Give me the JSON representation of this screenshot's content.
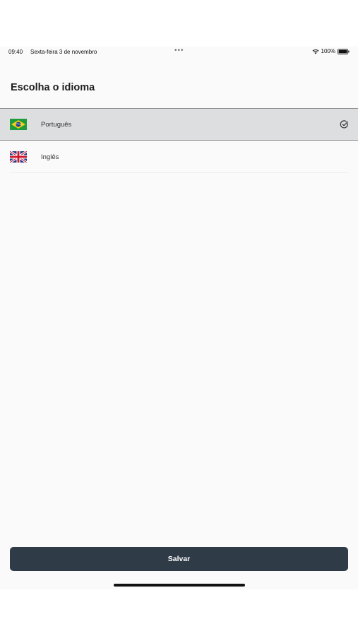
{
  "status_bar": {
    "time": "09:40",
    "date": "Sexta-feira 3 de novembro",
    "dots": "•••",
    "battery": "100%"
  },
  "page": {
    "title": "Escolha o idioma"
  },
  "languages": [
    {
      "label": "Português",
      "flag": "brazil-flag",
      "selected": true
    },
    {
      "label": "Inglês",
      "flag": "uk-flag",
      "selected": false
    }
  ],
  "actions": {
    "save_label": "Salvar"
  },
  "colors": {
    "button_bg": "#2f3b47",
    "selected_row_bg": "#dcdedf"
  }
}
